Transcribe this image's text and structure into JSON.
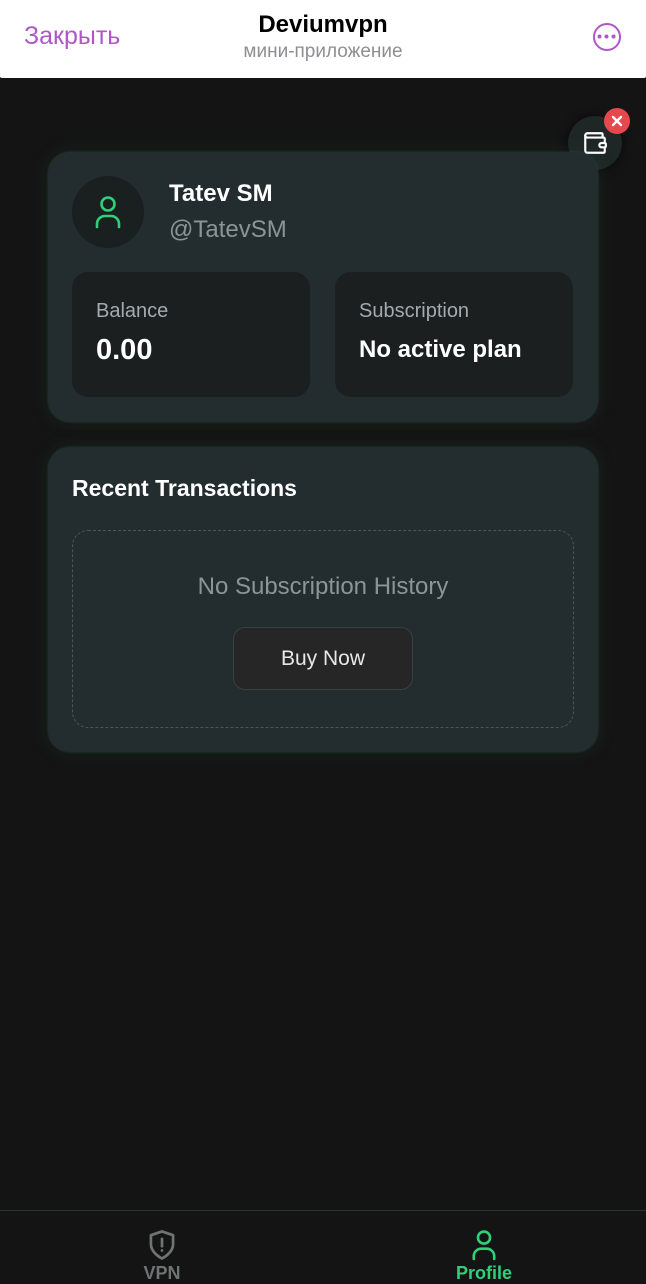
{
  "header": {
    "close_label": "Закрыть",
    "title": "Deviumvpn",
    "subtitle": "мини-приложение",
    "more_icon": "more-horizontal-icon"
  },
  "wallet": {
    "icon": "wallet-icon",
    "badge_icon": "close-x-icon"
  },
  "profile": {
    "avatar_icon": "user-icon",
    "name": "Tatev SM",
    "handle": "@TatevSM",
    "balance_label": "Balance",
    "balance_value": "0.00",
    "subscription_label": "Subscription",
    "subscription_value": "No active plan"
  },
  "transactions": {
    "title": "Recent Transactions",
    "empty_text": "No Subscription History",
    "buy_label": "Buy Now"
  },
  "nav": {
    "items": [
      {
        "label": "VPN",
        "icon": "shield-alert-icon",
        "active": false
      },
      {
        "label": "Profile",
        "icon": "user-icon",
        "active": true
      }
    ]
  },
  "colors": {
    "accent_green": "#2fd07a",
    "telegram_purple": "#b057c8",
    "background": "#141414",
    "card": "#232d2f"
  }
}
